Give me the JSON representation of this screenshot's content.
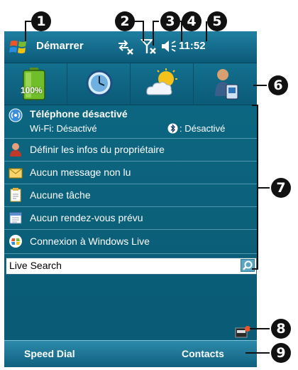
{
  "titlebar": {
    "start_label": "Démarrer",
    "clock": "11:52"
  },
  "today": {
    "battery_level": "100%",
    "phone": {
      "title": "Téléphone désactivé",
      "wifi": "Wi-Fi: Désactivé",
      "bluetooth": ": Désactivé"
    },
    "items": [
      {
        "label": "Définir les infos du propriétaire",
        "icon": "owner-icon"
      },
      {
        "label": "Aucun message non lu",
        "icon": "message-icon"
      },
      {
        "label": "Aucune tâche",
        "icon": "tasks-icon"
      },
      {
        "label": "Aucun rendez-vous prévu",
        "icon": "calendar-icon"
      },
      {
        "label": "Connexion à Windows Live",
        "icon": "windows-live-icon"
      }
    ],
    "search": {
      "value": "Live Search"
    }
  },
  "softkeys": {
    "left": "Speed Dial",
    "right": "Contacts"
  },
  "callouts": [
    "1",
    "2",
    "3",
    "4",
    "5",
    "6",
    "7",
    "8",
    "9"
  ],
  "colors": {
    "screen_bg": "#0b5f79",
    "titlebar": "#0c5a79",
    "callout": "#111111"
  }
}
